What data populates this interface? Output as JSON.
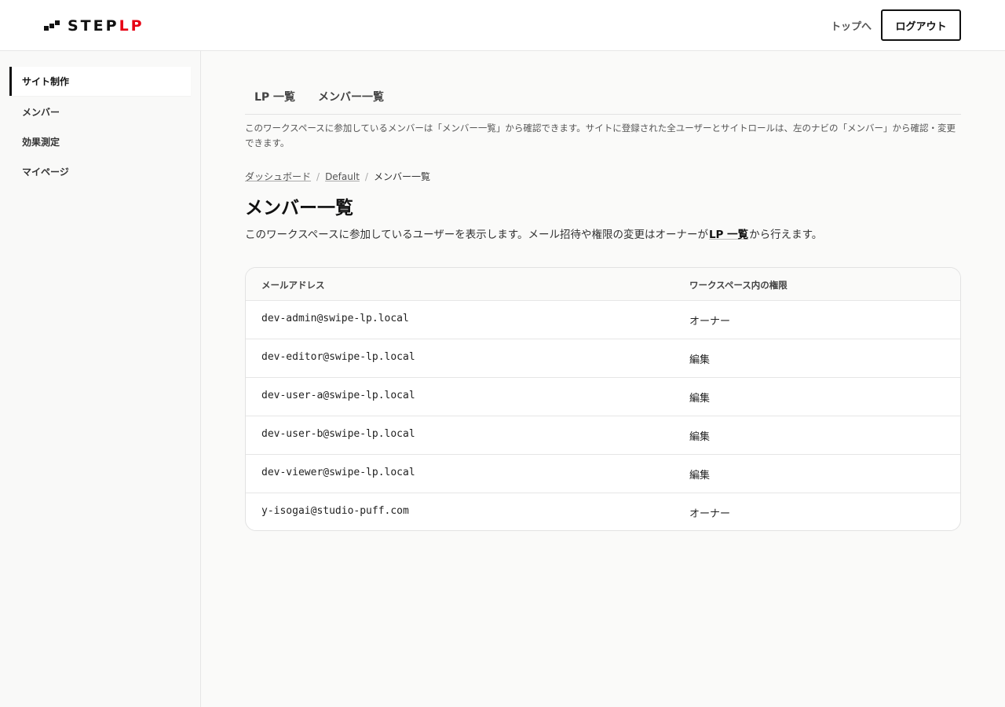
{
  "header": {
    "logo_main": "STEP",
    "logo_accent": "LP",
    "top_link": "トップへ",
    "logout_label": "ログアウト"
  },
  "sidebar": {
    "items": [
      {
        "label": "サイト制作",
        "active": true
      },
      {
        "label": "メンバー",
        "active": false
      },
      {
        "label": "効果測定",
        "active": false
      },
      {
        "label": "マイページ",
        "active": false
      }
    ]
  },
  "tabs": [
    {
      "label": "LP 一覧"
    },
    {
      "label": "メンバー一覧"
    }
  ],
  "notice": "このワークスペースに参加しているメンバーは「メンバー一覧」から確認できます。サイトに登録された全ユーザーとサイトロールは、左のナビの「メンバー」から確認・変更できます。",
  "breadcrumb": {
    "items": [
      "ダッシュボード",
      "Default"
    ],
    "current": "メンバー一覧"
  },
  "page": {
    "title": "メンバー一覧",
    "desc_before": "このワークスペースに参加しているユーザーを表示します。メール招待や権限の変更はオーナーが",
    "desc_link": "LP 一覧",
    "desc_after": "から行えます。"
  },
  "table": {
    "headers": {
      "email": "メールアドレス",
      "role": "ワークスペース内の権限"
    },
    "rows": [
      {
        "email": "dev-admin@swipe-lp.local",
        "role": "オーナー"
      },
      {
        "email": "dev-editor@swipe-lp.local",
        "role": "編集"
      },
      {
        "email": "dev-user-a@swipe-lp.local",
        "role": "編集"
      },
      {
        "email": "dev-user-b@swipe-lp.local",
        "role": "編集"
      },
      {
        "email": "dev-viewer@swipe-lp.local",
        "role": "編集"
      },
      {
        "email": "y-isogai@studio-puff.com",
        "role": "オーナー"
      }
    ]
  }
}
